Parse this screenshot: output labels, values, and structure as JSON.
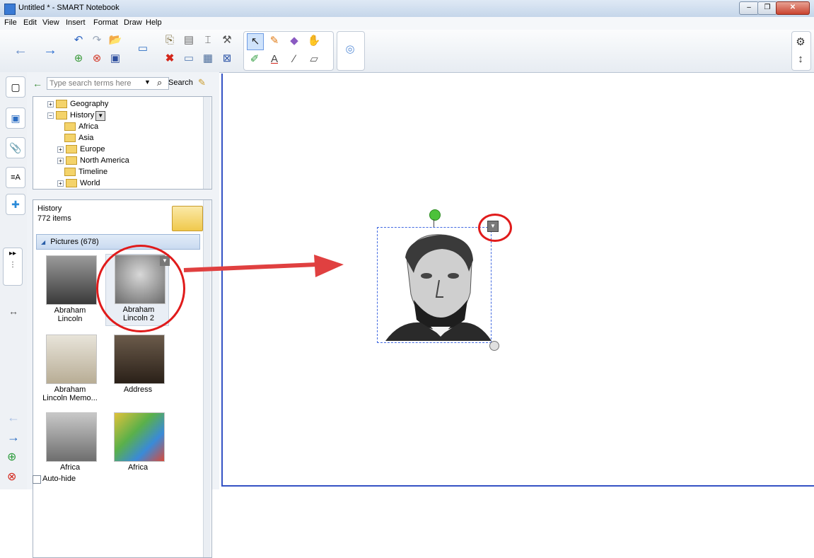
{
  "window": {
    "title": "Untitled * - SMART Notebook"
  },
  "menu": [
    "File",
    "Edit",
    "View",
    "Insert",
    "Format",
    "Draw",
    "Help"
  ],
  "gallery": {
    "search_placeholder": "Type search terms here",
    "search_label": "Search",
    "tree": [
      {
        "label": "Geography",
        "expanded": false
      },
      {
        "label": "History",
        "expanded": true
      },
      {
        "label": "Africa"
      },
      {
        "label": "Asia"
      },
      {
        "label": "Europe",
        "expanded": false
      },
      {
        "label": "North America",
        "expanded": false
      },
      {
        "label": "Timeline"
      },
      {
        "label": "World",
        "expanded": false
      }
    ],
    "folder_name": "History",
    "item_count": "772 items",
    "category": "Pictures (678)",
    "items": [
      {
        "label": "Abraham\nLincoln"
      },
      {
        "label": "Abraham\nLincoln 2"
      },
      {
        "label": "Abraham\nLincoln Memo..."
      },
      {
        "label": "Address"
      },
      {
        "label": "Africa"
      },
      {
        "label": "Africa"
      }
    ],
    "autohide_label": "Auto-hide"
  },
  "colors": {
    "accent": "#3452c4",
    "annotation": "#e01b1b",
    "rotate_handle": "#4cc23a"
  }
}
